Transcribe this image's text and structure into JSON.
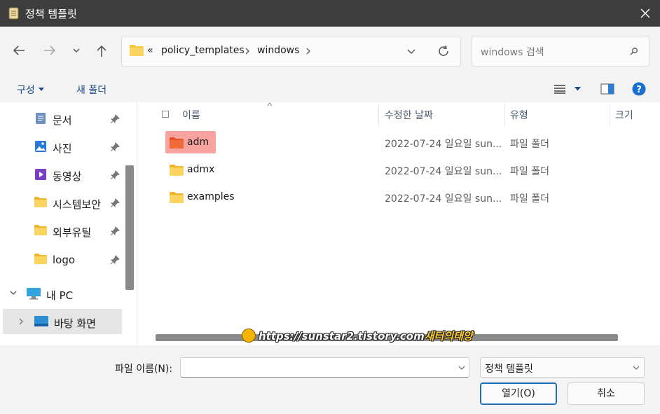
{
  "window": {
    "title": "정책 템플릿"
  },
  "address": {
    "overflow": "«",
    "crumbs": [
      "policy_templates",
      "windows"
    ]
  },
  "search": {
    "placeholder": "windows 검색"
  },
  "cmdbar": {
    "organize": "구성",
    "new_folder": "새 폴더"
  },
  "sidebar": {
    "items": [
      {
        "label": "문서",
        "icon": "document-icon",
        "pinned": true
      },
      {
        "label": "사진",
        "icon": "pictures-icon",
        "pinned": true
      },
      {
        "label": "동영상",
        "icon": "videos-icon",
        "pinned": true
      },
      {
        "label": "시스템보안",
        "icon": "folder-icon",
        "pinned": true
      },
      {
        "label": "외부유틸",
        "icon": "folder-icon",
        "pinned": true
      },
      {
        "label": "logo",
        "icon": "folder-icon",
        "pinned": true
      },
      {
        "label": "내 PC",
        "icon": "pc-icon",
        "expanded": true
      },
      {
        "label": "바탕 화면",
        "icon": "desktop-icon",
        "selected": true
      }
    ]
  },
  "columns": {
    "name": "이름",
    "modified": "수정한 날짜",
    "type": "유형",
    "size": "크기"
  },
  "files": [
    {
      "name": "adm",
      "modified": "2022-07-24 일요일 sun...",
      "type": "파일 폴더",
      "highlighted": true
    },
    {
      "name": "admx",
      "modified": "2022-07-24 일요일 sun...",
      "type": "파일 폴더"
    },
    {
      "name": "examples",
      "modified": "2022-07-24 일요일 sun...",
      "type": "파일 폴더"
    }
  ],
  "watermark": {
    "url": "https://sunstar2.tistory.com",
    "brand": "새터의태양"
  },
  "footer": {
    "filename_label": "파일 이름(N):",
    "filename_value": "",
    "filter_value": "정책 템플릿",
    "open_label": "열기(O)",
    "cancel_label": "취소"
  },
  "colors": {
    "accent": "#1a6fb8",
    "folder": "#f8c83c",
    "highlight": "#f9a3a0",
    "titlebar": "#3d3d3d"
  }
}
